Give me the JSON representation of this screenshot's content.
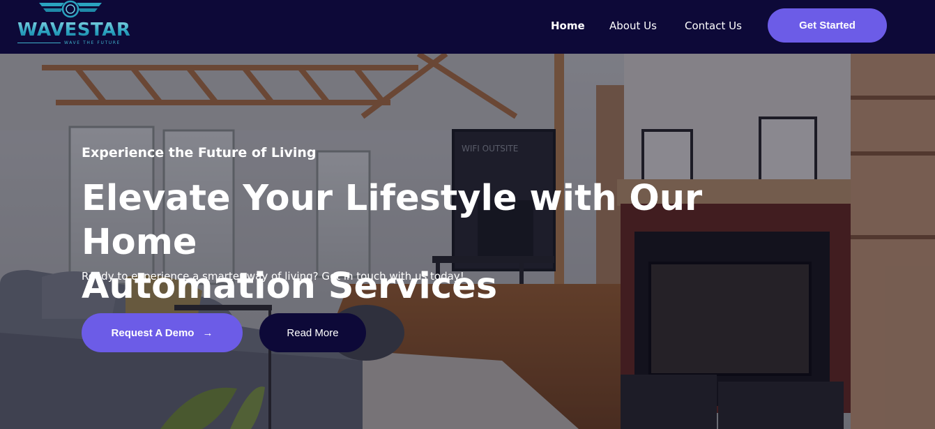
{
  "brand": {
    "name": "WAVESTAR",
    "tagline": "WAVE THE FUTURE"
  },
  "nav": {
    "items": [
      {
        "label": "Home",
        "active": true
      },
      {
        "label": "About Us",
        "active": false
      },
      {
        "label": "Contact Us",
        "active": false
      }
    ],
    "cta_label": "Get Started"
  },
  "hero": {
    "eyebrow": "Experience the Future of Living",
    "headline_line1": "Elevate Your Lifestyle with Our Home",
    "headline_line2": "Automation Services",
    "subtitle": "Ready to experience a smarter way of living? Get in touch with us today!",
    "primary_button": "Request A Demo",
    "primary_button_icon": "arrow-right-icon",
    "secondary_button": "Read More",
    "tv_screen_text": "WIFI OUTSITE"
  },
  "colors": {
    "header_bg": "#0d0938",
    "accent": "#6c5ce7",
    "dark_button": "#0d0938",
    "logo": "#2aa3c0"
  }
}
